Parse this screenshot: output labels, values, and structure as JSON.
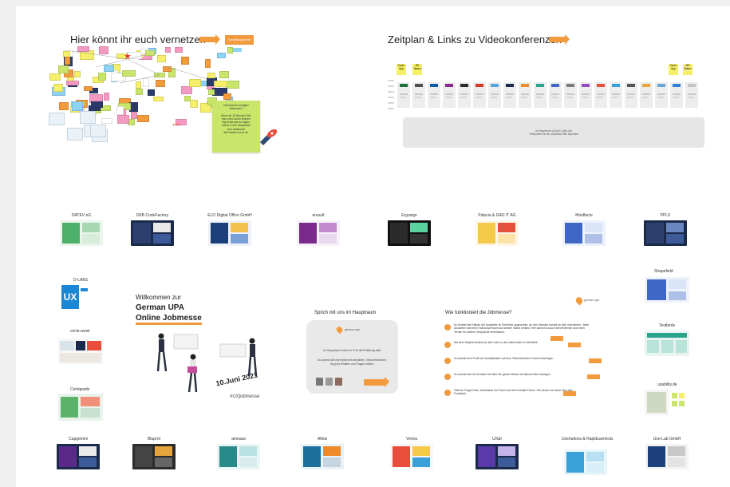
{
  "board": {
    "network": {
      "title": "Hier könnt ihr euch vernetzen",
      "tag": "Vorstellungsrunde",
      "note_lines": [
        "Interesse an heutigen",
        "Jobmesse?!",
        "",
        "Nimm dir 15 Minuten Zeit,",
        "lese und Lust an deinem",
        "Tag heute das zu sagen,",
        "komm in den Hauptraum",
        "zum Austausch",
        "alle Details mit dir ab."
      ]
    },
    "schedule": {
      "title": "Zeitplan & Links zu Videokonferenzen",
      "zoom_label": "Zoom App",
      "teams_label": "MS Teams",
      "center_lines": [
        "Im Hauptraum (Zoom) Links und",
        "Treffpunkte für die Jobmesse bitte beachten"
      ]
    },
    "exhibitors_row1": [
      {
        "name": "DATEV eG"
      },
      {
        "name": "DKB CodeFactory"
      },
      {
        "name": "ELO Digital Office GmbH"
      },
      {
        "name": "eresult"
      },
      {
        "name": "Ergosign"
      },
      {
        "name": "Fiducia & GAD IT AG"
      },
      {
        "name": "Mindfacts"
      },
      {
        "name": "PPI.X"
      }
    ],
    "exhibitors_left": [
      {
        "name": "D-LABS"
      },
      {
        "name": "circle.week"
      },
      {
        "name": "Centigrade"
      }
    ],
    "exhibitors_right": [
      {
        "name": "Shapefield"
      },
      {
        "name": "Testbirds"
      },
      {
        "name": "usability.de"
      }
    ],
    "exhibitors_row3": [
      {
        "name": "Capgemini"
      },
      {
        "name": "Bluprnt"
      },
      {
        "name": "ameaus"
      },
      {
        "name": "Aflow"
      },
      {
        "name": "Veriva"
      },
      {
        "name": "UX&I"
      },
      {
        "name": "Userlutions & Rapidusertests"
      },
      {
        "name": "Use-Lab GmbH"
      }
    ],
    "welcome": {
      "line1": "Willkommen zur",
      "line2": "German UPA",
      "line3": "Online Jobmesse",
      "date": "10.Juni 2021",
      "hashtag": "#UXjobmesse",
      "ux_logo": "UX"
    },
    "mainroom": {
      "title": "Sprich mit uns im Hauptraum",
      "brand": "german upa",
      "text1": "Im Hauptraum findet um 9:30 die Eröffnung statt.",
      "text2": "Du kannst dich hier jederzeit einwählen, Infos bekommen, Support erhalten und Fragen stellen."
    },
    "howto": {
      "title": "Wie funktioniert die Jobmesse?",
      "brand": "german upa",
      "steps": [
        "Du findest alle Stände der Aussteller im Rechteck angeordnet. An den Ständen kannst du dich informieren. Jeder Aussteller hat einen Videochat Raum auf seinem Stand verlinkt. Hier kannst du auch kennenlernen und einen Termin für weitere Gespräche vereinbaren.",
        "Auf dem Zeitplan findest du alle Links zu den Videochats im Überblick",
        "Du kannst dein Profil und Kontaktdaten auf dem Teilnehmenden Frame hinterlegen",
        "Du kannst dich mit Scrollen frei über die ganze Messe auf diesem Miro bewegen",
        "Falls du Fragen hast, hinterlasse ein Post-It auf dem Kontakt Frame. Wir freuen uns auch über dein Feedback."
      ]
    }
  },
  "colors": {
    "accent": "#f29a3e",
    "sticky_yellow": "#f5ef6a",
    "sticky_green": "#c9e66b",
    "sticky_pink": "#f49ac2",
    "sticky_blue": "#8fd3f4",
    "navy": "#1b2a4a"
  }
}
